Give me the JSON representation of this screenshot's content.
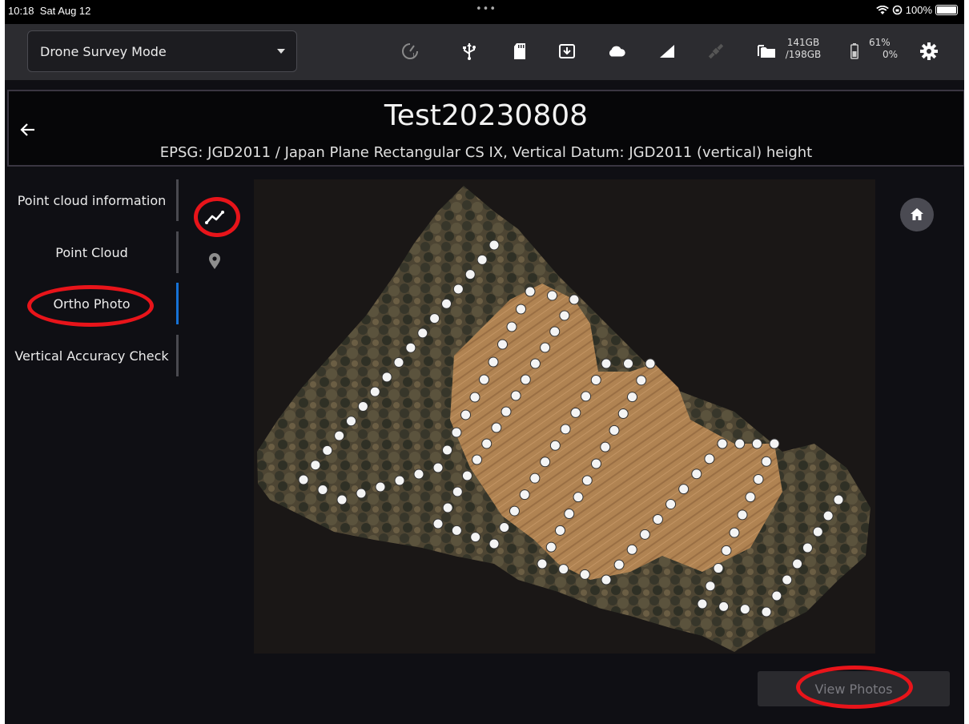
{
  "status_bar": {
    "time": "10:18",
    "date": "Sat Aug 12",
    "dots": "•••",
    "battery": "100%"
  },
  "toolbar": {
    "mode": "Drone Survey Mode",
    "storage_used": "141GB",
    "storage_total": "/198GB",
    "battery_1": "61%",
    "battery_2": "0%"
  },
  "project": {
    "title": "Test20230808",
    "crs": "EPSG: JGD2011 / Japan Plane Rectangular CS IX, Vertical Datum: JGD2011 (vertical) height"
  },
  "nav": {
    "items": [
      {
        "label": "Point cloud information",
        "active": false
      },
      {
        "label": "Point Cloud",
        "active": false
      },
      {
        "label": "Ortho Photo",
        "active": true
      },
      {
        "label": "Vertical Accuracy Check",
        "active": false
      }
    ]
  },
  "actions": {
    "view_photos": "View Photos"
  },
  "colors": {
    "accent": "#1672d6",
    "annotation": "#e8141a",
    "background": "#0f0f14"
  }
}
